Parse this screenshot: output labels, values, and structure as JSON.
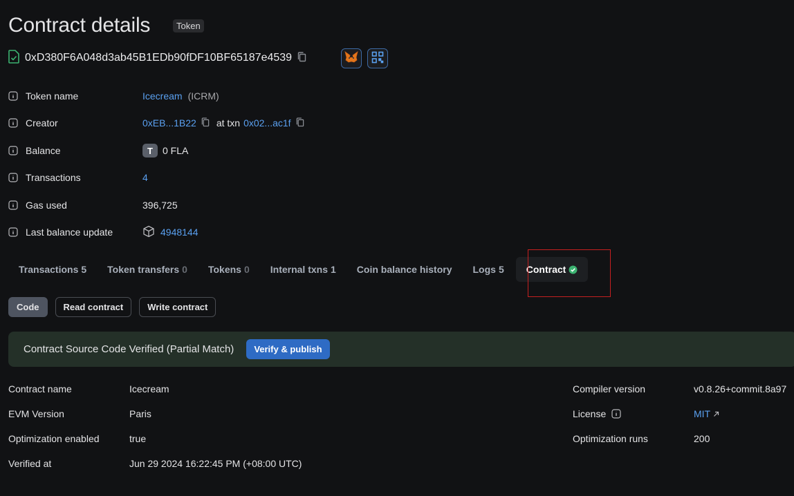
{
  "header": {
    "title": "Contract details",
    "badge": "Token"
  },
  "address": {
    "value": "0xD380F6A048d3ab45B1EDb90fDF10BF65187e4539"
  },
  "info": {
    "token_name_label": "Token name",
    "token_name": "Icecream",
    "token_symbol": "(ICRM)",
    "creator_label": "Creator",
    "creator": "0xEB...1B22",
    "at_txn": "at txn",
    "txn": "0x02...ac1f",
    "balance_label": "Balance",
    "balance_token_letter": "T",
    "balance": "0 FLA",
    "transactions_label": "Transactions",
    "transactions": "4",
    "gas_label": "Gas used",
    "gas": "396,725",
    "last_update_label": "Last balance update",
    "last_update": "4948144"
  },
  "tabs": [
    {
      "label": "Transactions",
      "count": "5"
    },
    {
      "label": "Token transfers",
      "count": "0"
    },
    {
      "label": "Tokens",
      "count": "0"
    },
    {
      "label": "Internal txns",
      "count": "1"
    },
    {
      "label": "Coin balance history",
      "count": ""
    },
    {
      "label": "Logs",
      "count": "5"
    },
    {
      "label": "Contract",
      "count": ""
    }
  ],
  "subtabs": [
    "Code",
    "Read contract",
    "Write contract"
  ],
  "verified": {
    "text": "Contract Source Code Verified (Partial Match)",
    "button": "Verify & publish"
  },
  "details": {
    "contract_name_label": "Contract name",
    "contract_name": "Icecream",
    "evm_label": "EVM Version",
    "evm": "Paris",
    "opt_label": "Optimization enabled",
    "opt": "true",
    "verified_at_label": "Verified at",
    "verified_at": "Jun 29 2024 16:22:45 PM (+08:00 UTC)",
    "compiler_label": "Compiler version",
    "compiler": "v0.8.26+commit.8a97",
    "license_label": "License",
    "license": "MIT",
    "runs_label": "Optimization runs",
    "runs": "200"
  },
  "colors": {
    "link": "#5aa0f0",
    "accent": "#2e6bc4",
    "success": "#3cb371",
    "highlight": "#c62020"
  }
}
